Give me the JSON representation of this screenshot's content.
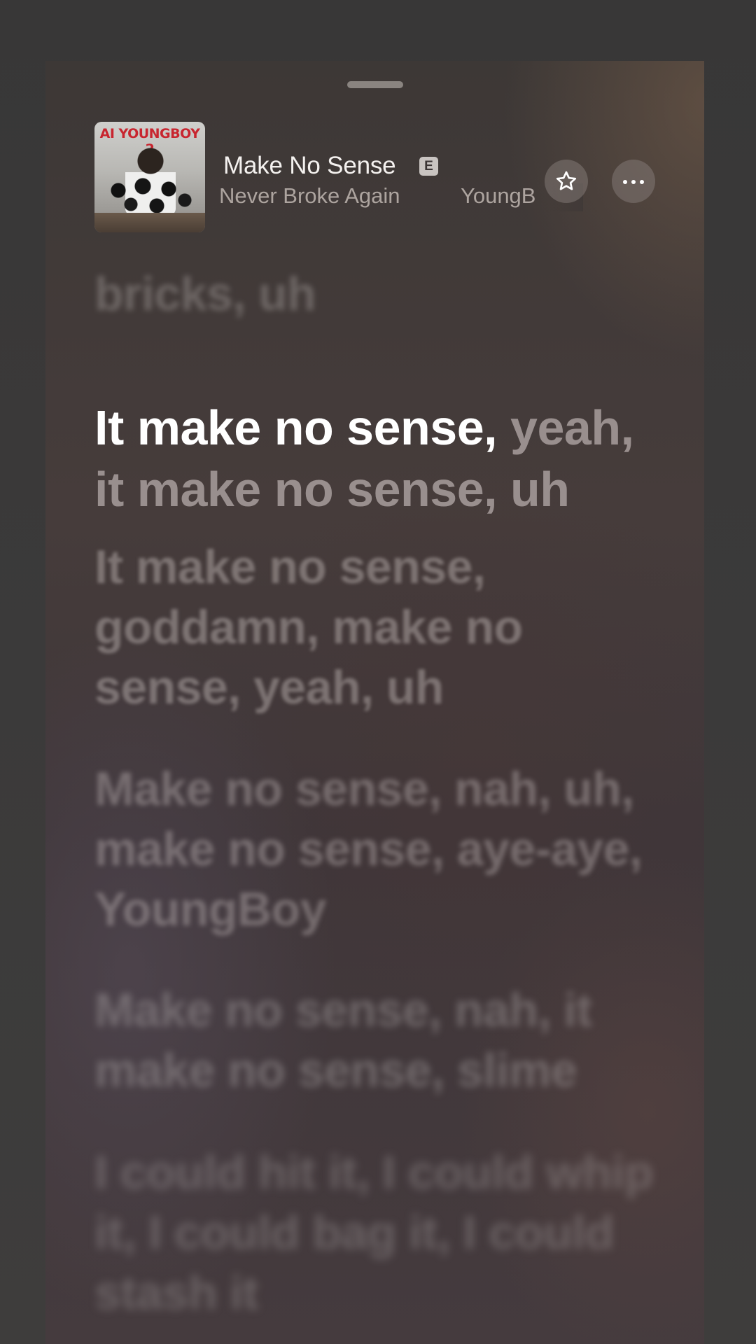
{
  "header": {
    "album_art": {
      "title_text": "AI YOUNGBOY 2",
      "accent_color": "#c8252f"
    },
    "song_title": "Make No Sense",
    "explicit_badge": "E",
    "album": "Never Broke Again",
    "artist_partial": "YoungB",
    "favorite_icon": "star-icon",
    "more_icon": "more-icon"
  },
  "lyrics": {
    "previous": "bricks, uh",
    "active_sung": "It make no sense,",
    "active_rest_line1": " yeah,",
    "active_rest_line2": "it make no sense, uh",
    "upcoming": [
      "It make no sense, goddamn, make no sense, yeah, uh",
      "Make no sense, nah, uh, make no sense, aye-aye, YoungBoy",
      "Make no sense, nah, it make no sense, slime",
      "I could hit it, I could whip it, I could bag it, I could stash it"
    ]
  },
  "colors": {
    "sung_text": "#ffffff",
    "unsung_text": "#cdc4c2",
    "background": "#3a3939"
  }
}
